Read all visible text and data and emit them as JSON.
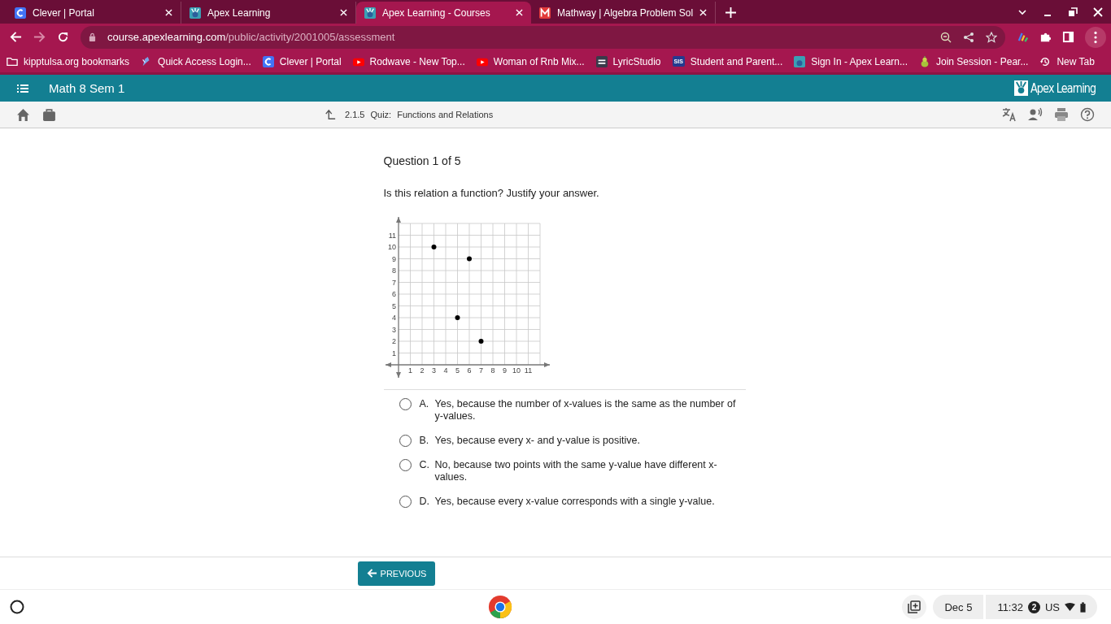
{
  "tabs": [
    {
      "title": "Clever | Portal",
      "kind": "clever",
      "selected": false
    },
    {
      "title": "Apex Learning",
      "kind": "apex",
      "selected": false
    },
    {
      "title": "Apex Learning - Courses",
      "kind": "apex",
      "selected": true
    },
    {
      "title": "Mathway | Algebra Problem Sol",
      "kind": "mathway",
      "selected": false
    }
  ],
  "address": {
    "host": "course.apexlearning.com",
    "path": "/public/activity/2001005/assessment"
  },
  "bookmarks": [
    {
      "label": "kipptulsa.org bookmarks",
      "kind": "folder"
    },
    {
      "label": "Quick Access Login...",
      "kind": "bird"
    },
    {
      "label": "Clever | Portal",
      "kind": "clever"
    },
    {
      "label": "Rodwave - New Top...",
      "kind": "youtube"
    },
    {
      "label": "Woman of Rnb Mix...",
      "kind": "youtube"
    },
    {
      "label": "LyricStudio",
      "kind": "lyric"
    },
    {
      "label": "Student and Parent...",
      "kind": "sis",
      "icon_text": "SIS"
    },
    {
      "label": "Sign In - Apex Learn...",
      "kind": "apex"
    },
    {
      "label": "Join Session - Pear...",
      "kind": "pear"
    },
    {
      "label": "New Tab",
      "kind": "history"
    }
  ],
  "course": {
    "title": "Math 8 Sem 1",
    "brand": "Apex Learning"
  },
  "activity": {
    "number": "2.1.5",
    "type": "Quiz:",
    "title": "Functions and Relations"
  },
  "question": {
    "counter": "Question 1 of 5",
    "prompt": "Is this relation a function? Justify your answer.",
    "chart_data": {
      "type": "scatter",
      "x": [
        3,
        6,
        5,
        7
      ],
      "series": [
        {
          "color": "#000000",
          "values": [
            10,
            9,
            4,
            2
          ]
        }
      ],
      "xlim": [
        0,
        12
      ],
      "ylim": [
        0,
        12
      ],
      "grid": true,
      "xticks": [
        1,
        2,
        3,
        4,
        5,
        6,
        7,
        8,
        9,
        10,
        11
      ],
      "yticks": [
        1,
        2,
        3,
        4,
        5,
        6,
        7,
        8,
        9,
        10,
        11
      ]
    },
    "options": [
      {
        "letter": "A.",
        "text": "Yes, because the number of x-values is the same as the number of y-values.",
        "selected": false
      },
      {
        "letter": "B.",
        "text": "Yes, because every x- and y-value is positive.",
        "selected": false
      },
      {
        "letter": "C.",
        "text": "No, because two points with the same y-value have different x-values.",
        "selected": false
      },
      {
        "letter": "D.",
        "text": "Yes, because every x-value corresponds with a single y-value.",
        "selected": false
      }
    ]
  },
  "previous_button": "PREVIOUS",
  "shelf": {
    "date": "Dec 5",
    "time": "11:32",
    "notifications": "2",
    "keyboard": "US"
  }
}
